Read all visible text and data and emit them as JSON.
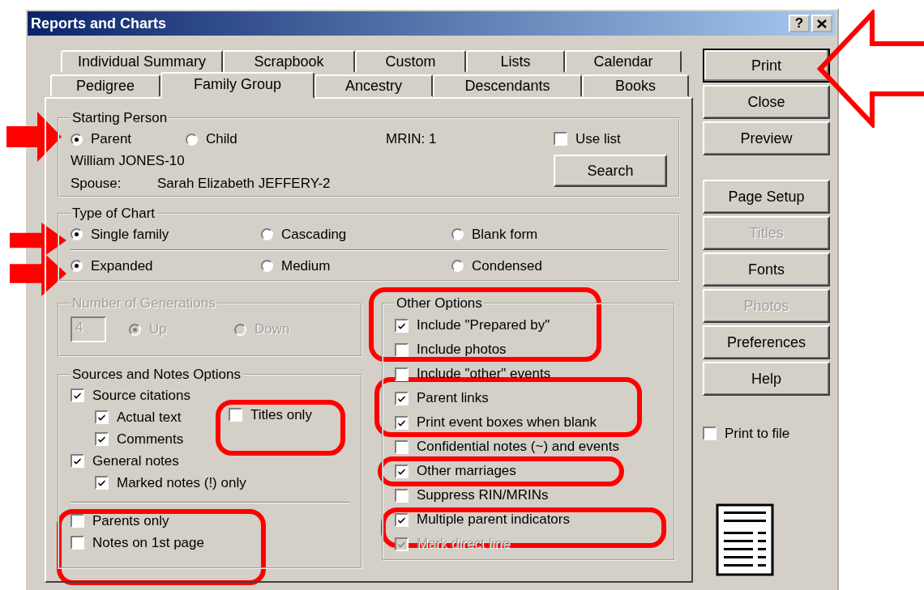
{
  "window": {
    "title": "Reports and Charts",
    "help_button": "?"
  },
  "tabs": [
    [
      {
        "label": "Individual Summary",
        "selected": false
      },
      {
        "label": "Scrapbook",
        "selected": false
      },
      {
        "label": "Custom",
        "selected": false
      },
      {
        "label": "Lists",
        "selected": false
      },
      {
        "label": "Calendar",
        "selected": false
      }
    ],
    [
      {
        "label": "Pedigree",
        "selected": false
      },
      {
        "label": "Family Group",
        "selected": true
      },
      {
        "label": "Ancestry",
        "selected": false
      },
      {
        "label": "Descendants",
        "selected": false
      },
      {
        "label": "Books",
        "selected": false
      }
    ]
  ],
  "starting_person": {
    "title": "Starting Person",
    "options": [
      {
        "label": "Parent",
        "selected": true
      },
      {
        "label": "Child",
        "selected": false
      }
    ],
    "mrin": "MRIN: 1",
    "use_list": {
      "label": "Use list",
      "checked": false
    },
    "person": "William JONES-10",
    "spouse_label": "Spouse:",
    "spouse": "Sarah Elizabeth JEFFERY-2",
    "search_button": "Search"
  },
  "type_of_chart": {
    "title": "Type of Chart",
    "format": [
      {
        "label": "Single family",
        "selected": true
      },
      {
        "label": "Cascading",
        "selected": false
      },
      {
        "label": "Blank form",
        "selected": false
      }
    ],
    "size": [
      {
        "label": "Expanded",
        "selected": true
      },
      {
        "label": "Medium",
        "selected": false
      },
      {
        "label": "Condensed",
        "selected": false
      }
    ]
  },
  "generations": {
    "title": "Number of Generations",
    "disabled": true,
    "value": "4",
    "options": [
      {
        "label": "Up",
        "selected": true
      },
      {
        "label": "Down",
        "selected": false
      }
    ]
  },
  "sources": {
    "title": "Sources and Notes Options",
    "items": [
      {
        "label": "Source citations",
        "checked": true,
        "children": [
          {
            "label": "Actual text",
            "checked": true
          },
          {
            "label": "Comments",
            "checked": true
          }
        ]
      },
      {
        "label": "General notes",
        "checked": true,
        "children": [
          {
            "label": "Marked notes (!) only",
            "checked": true
          }
        ]
      }
    ],
    "titles_only": {
      "label": "Titles only",
      "checked": false
    },
    "bottom_items": [
      {
        "label": "Parents only",
        "checked": false
      },
      {
        "label": "Notes on 1st page",
        "checked": false
      }
    ]
  },
  "other_options": {
    "title": "Other Options",
    "items": [
      {
        "label": "Include \"Prepared by\"",
        "checked": true,
        "disabled": false
      },
      {
        "label": "Include photos",
        "checked": false,
        "disabled": false
      },
      {
        "label": "Include \"other\" events",
        "checked": false,
        "disabled": false
      },
      {
        "label": "Parent links",
        "checked": true,
        "disabled": false
      },
      {
        "label": "Print event boxes when blank",
        "checked": true,
        "disabled": false
      },
      {
        "label": "Confidential notes (~) and events",
        "checked": false,
        "disabled": false
      },
      {
        "label": "Other marriages",
        "checked": true,
        "disabled": false
      },
      {
        "label": "Suppress RIN/MRINs",
        "checked": false,
        "disabled": false
      },
      {
        "label": "Multiple parent indicators",
        "checked": true,
        "disabled": false
      },
      {
        "label": "Mark direct line",
        "checked": true,
        "disabled": true
      }
    ]
  },
  "buttons": [
    {
      "label": "Print",
      "disabled": false
    },
    {
      "label": "Close",
      "disabled": false
    },
    {
      "label": "Preview",
      "disabled": false
    },
    {
      "label": "Page Setup",
      "disabled": false
    },
    {
      "label": "Titles",
      "disabled": true
    },
    {
      "label": "Fonts",
      "disabled": false
    },
    {
      "label": "Photos",
      "disabled": true
    },
    {
      "label": "Preferences",
      "disabled": false
    },
    {
      "label": "Help",
      "disabled": false
    }
  ],
  "print_to_file": {
    "label": "Print to file",
    "checked": false
  }
}
